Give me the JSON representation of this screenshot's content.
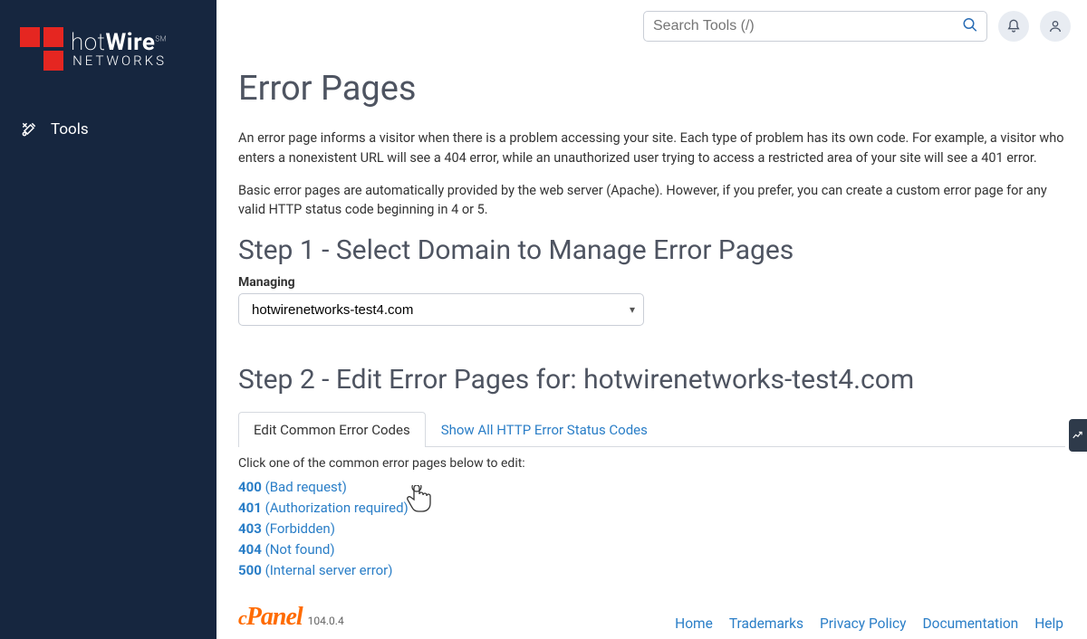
{
  "brand": {
    "name_html_line1": "hotWire",
    "sm": "SM",
    "line2": "NETWORKS"
  },
  "sidebar": {
    "tools_label": "Tools"
  },
  "topbar": {
    "search_placeholder": "Search Tools (/)"
  },
  "page": {
    "title": "Error Pages",
    "intro1": "An error page informs a visitor when there is a problem accessing your site. Each type of problem has its own code. For example, a visitor who enters a nonexistent URL will see a 404 error, while an unauthorized user trying to access a restricted area of your site will see a 401 error.",
    "intro2": "Basic error pages are automatically provided by the web server (Apache). However, if you prefer, you can create a custom error page for any valid HTTP status code beginning in 4 or 5.",
    "step1_title": "Step 1 - Select Domain to Manage Error Pages",
    "managing_label": "Managing",
    "selected_domain": "hotwirenetworks-test4.com",
    "step2_title": "Step 2 - Edit Error Pages for: hotwirenetworks-test4.com",
    "tab_common": "Edit Common Error Codes",
    "tab_all": "Show All HTTP Error Status Codes",
    "tab_desc": "Click one of the common error pages below to edit:",
    "errors": [
      {
        "code": "400",
        "name": "(Bad request)"
      },
      {
        "code": "401",
        "name": "(Authorization required)"
      },
      {
        "code": "403",
        "name": "(Forbidden)"
      },
      {
        "code": "404",
        "name": "(Not found)"
      },
      {
        "code": "500",
        "name": "(Internal server error)"
      }
    ]
  },
  "footer": {
    "version": "104.0.4",
    "links": [
      {
        "label": "Home"
      },
      {
        "label": "Trademarks"
      },
      {
        "label": "Privacy Policy"
      },
      {
        "label": "Documentation"
      },
      {
        "label": "Help"
      }
    ]
  }
}
